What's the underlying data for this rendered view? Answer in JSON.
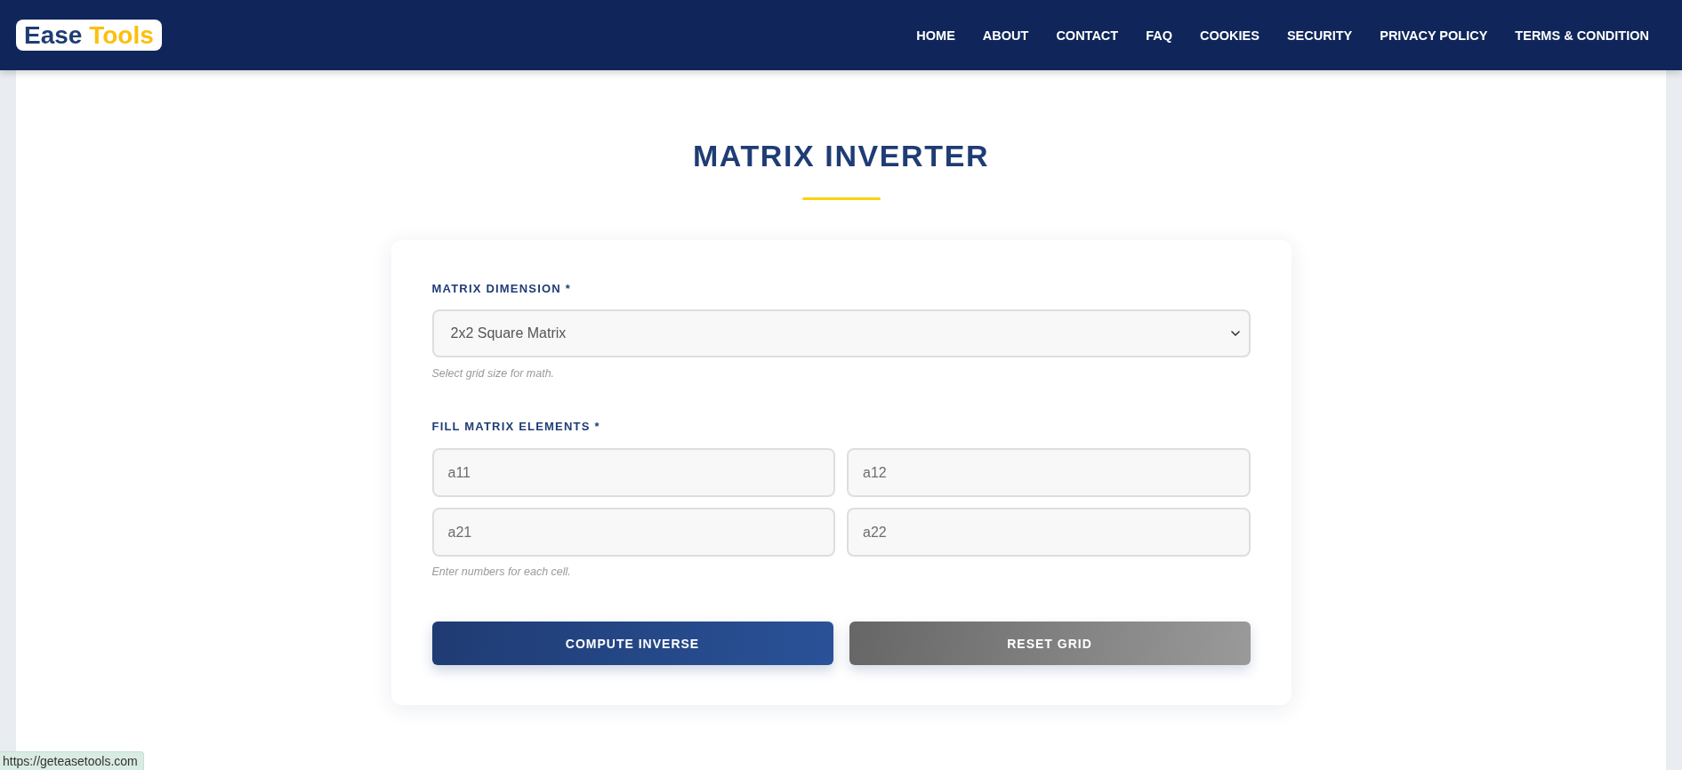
{
  "header": {
    "logo": {
      "primary": "Ease",
      "accent": "Tools"
    },
    "nav": [
      "HOME",
      "ABOUT",
      "CONTACT",
      "FAQ",
      "COOKIES",
      "SECURITY",
      "PRIVACY POLICY",
      "TERMS & CONDITION"
    ]
  },
  "page_title": "MATRIX INVERTER",
  "form": {
    "fields": [
      {
        "kind": "select",
        "label": "MATRIX DIMENSION *",
        "value": "2x2 Square Matrix",
        "hint": "Select grid size for math."
      },
      {
        "kind": "grid",
        "label": "FILL MATRIX ELEMENTS *",
        "rows": [
          [
            {
              "placeholder": "a11"
            },
            {
              "placeholder": "a12"
            }
          ],
          [
            {
              "placeholder": "a21"
            },
            {
              "placeholder": "a22"
            }
          ]
        ],
        "hint": "Enter numbers for each cell."
      }
    ],
    "buttons": [
      {
        "kind": "primary",
        "label": "COMPUTE INVERSE"
      },
      {
        "kind": "secondary",
        "label": "RESET GRID"
      }
    ]
  },
  "status_bar": {
    "url": "https://geteasetools.com"
  }
}
